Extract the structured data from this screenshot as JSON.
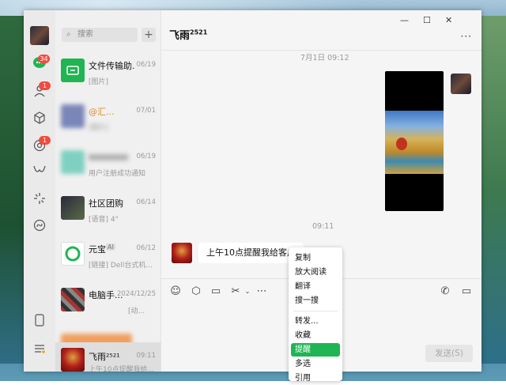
{
  "window": {
    "min_label": "—",
    "max_label": "☐",
    "close_label": "✕"
  },
  "rail": {
    "chat_badge": "34",
    "contacts_badge": "1",
    "moments_badge": "1"
  },
  "search": {
    "placeholder": "搜索",
    "plus": "+"
  },
  "chats": [
    {
      "name": "文件传输助...",
      "time": "06/19",
      "sub": "[图片]"
    },
    {
      "name": "@汇...",
      "time": "07/01",
      "sub": "[图片]"
    },
    {
      "name": "",
      "time": "06/19",
      "sub": "用户注册成功通知"
    },
    {
      "name": "社区团购",
      "time": "06/14",
      "sub": "[语音] 4\""
    },
    {
      "name": "元宝",
      "tag": "AI",
      "time": "06/12",
      "sub": "[链接] Dell台式机..."
    },
    {
      "name": "电脑手...",
      "time": "2024/12/25",
      "sub": "[动..."
    },
    {
      "name": "",
      "time": "",
      "sub": ""
    },
    {
      "name": "飞雨²⁵²¹",
      "time": "09:11",
      "sub": "上午10点提醒我给..."
    }
  ],
  "chat": {
    "title": "飞雨",
    "title_sup": "2521",
    "more": "···",
    "timestamp1": "7月1日 09:12",
    "timestamp2": "09:11",
    "message": "上午10点提醒我给客户",
    "send_label": "发送(S)"
  },
  "menu": {
    "items": [
      "复制",
      "放大阅读",
      "翻译",
      "搜一搜",
      "转发...",
      "收藏",
      "提醒",
      "多选",
      "引用"
    ],
    "highlighted": "提醒"
  },
  "colors": {
    "accent": "#1fb552",
    "badge": "#f14b3e"
  }
}
